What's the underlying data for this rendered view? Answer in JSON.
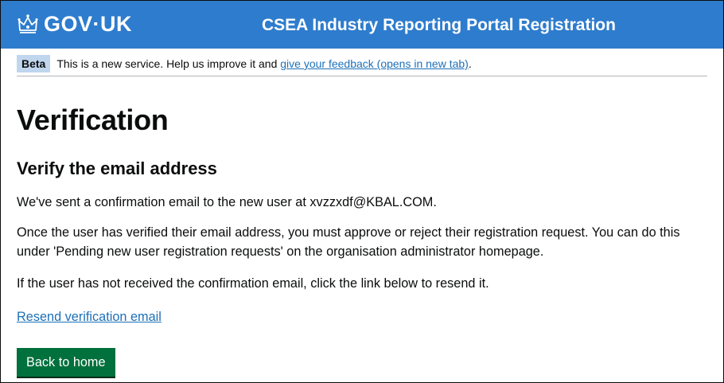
{
  "header": {
    "logo_text": "GOV·UK",
    "logo_icon": "crown-icon",
    "service_name": "CSEA Industry Reporting Portal Registration",
    "background_color": "#2e7ccd"
  },
  "phase_banner": {
    "tag": "Beta",
    "text": "This is a new service. Help us improve it and",
    "link_text": "give your feedback (opens in new tab)",
    "trailing": "."
  },
  "main": {
    "title": "Verification",
    "subtitle": "Verify the email address",
    "confirmation_text": "We've sent a confirmation email to the new user at xvzzxdf@KBAL.COM.",
    "instructions_text": "Once the user has verified their email address, you must approve or reject their registration request. You can do this under 'Pending new user registration requests' on the organisation administrator homepage.",
    "resend_hint": "If the user has not received the confirmation email, click the link below to resend it.",
    "resend_link": "Resend verification email",
    "back_button": "Back to home",
    "button_color": "#00703c"
  }
}
